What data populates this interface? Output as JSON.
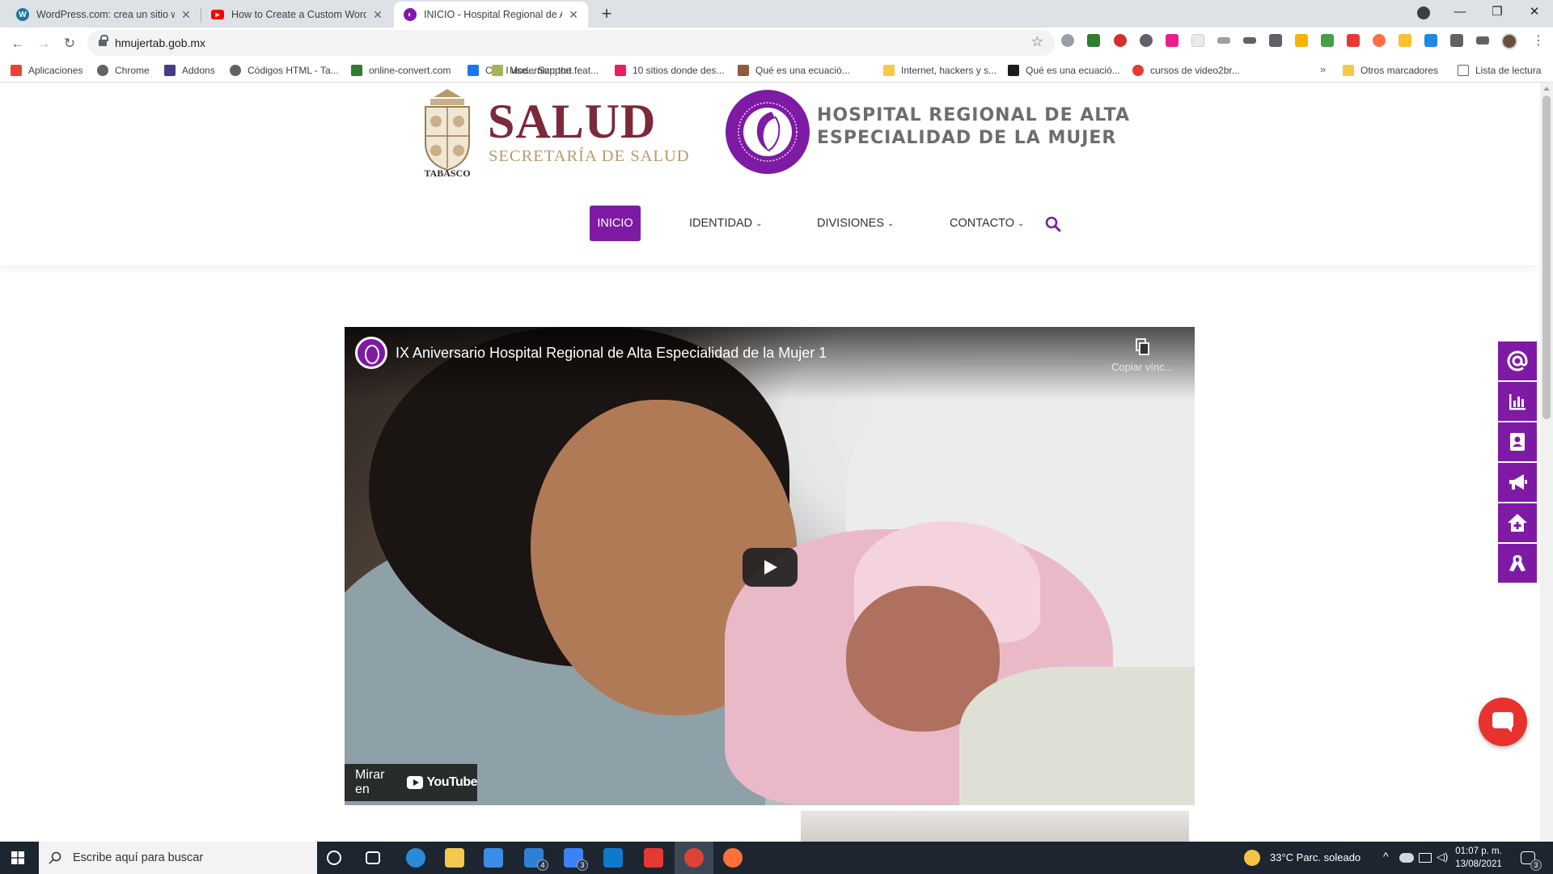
{
  "browser": {
    "tabs": [
      {
        "title": "WordPress.com: crea un sitio web",
        "favicon": "wordpress-icon",
        "color": "#21759b"
      },
      {
        "title": "How to Create a Custom WordPress",
        "favicon": "youtube-icon",
        "color": "#ff0000"
      },
      {
        "title": "INICIO - Hospital Regional de Alta",
        "favicon": "hospital-icon",
        "color": "#7e1aa4"
      }
    ],
    "new_tab": "+",
    "url": "hmujertab.gob.mx",
    "bookmarks": [
      {
        "label": "Aplicaciones",
        "icon": "apps-grid-icon",
        "color": "#ea4335"
      },
      {
        "label": "Chrome",
        "icon": "globe-icon",
        "color": "#5f6368"
      },
      {
        "label": "Addons",
        "icon": "addons-icon",
        "color": "#4b3a8c"
      },
      {
        "label": "Códigos HTML - Ta...",
        "icon": "globe-icon",
        "color": "#5f6368"
      },
      {
        "label": "online-convert.com",
        "icon": "convert-icon",
        "color": "#2e7d32"
      },
      {
        "label": "Can I use... Support...",
        "icon": "facebook-icon",
        "color": "#1877f2"
      },
      {
        "label": "Modernizr: the feat...",
        "icon": "bookmark-icon",
        "color": "#a6b35c"
      },
      {
        "label": "10 sitios donde des...",
        "icon": "bookmark-icon",
        "color": "#e91e63"
      },
      {
        "label": "Internet, hackers y s...",
        "icon": "folder-icon",
        "color": "#f6c945"
      },
      {
        "label": "Qué es una ecuació...",
        "icon": "bookmark-icon",
        "color": "#8d5a3b"
      },
      {
        "label": "cursos de video2br...",
        "icon": "bookmark-icon",
        "color": "#f4a340"
      },
      {
        "label": "Otros marcadores",
        "icon": "folder-icon",
        "color": "#f6c945"
      },
      {
        "label": "Lista de lectura",
        "icon": "reading-list-icon",
        "color": "#5f6368"
      }
    ],
    "bookmarks_more": "»"
  },
  "header": {
    "tabasco": "TABASCO",
    "salud": "SALUD",
    "secretaria": "SECRETARÍA DE SALUD",
    "hospital_line1": "HOSPITAL REGIONAL DE ALTA",
    "hospital_line2": "ESPECIALIDAD DE LA MUJER"
  },
  "nav": {
    "items": [
      "INICIO",
      "IDENTIDAD",
      "DIVISIONES",
      "CONTACTO"
    ],
    "active": "INICIO",
    "accent": "#7e1aa4"
  },
  "video": {
    "title": "IX Aniversario Hospital Regional de Alta Especialidad de la Mujer 1",
    "copy_link": "Copiar vínc...",
    "watch_on": "Mirar en",
    "platform": "YouTube"
  },
  "side_buttons": [
    "at-icon",
    "chart-icon",
    "contact-book-icon",
    "megaphone-icon",
    "home-plus-icon",
    "ribbon-icon"
  ],
  "taskbar": {
    "search_placeholder": "Escribe aquí para buscar",
    "weather": "33°C  Parc. soleado",
    "time": "01:07 p. m.",
    "date": "13/08/2021",
    "notifications": "3",
    "mail_badge": "4",
    "todo_badge": "3"
  }
}
